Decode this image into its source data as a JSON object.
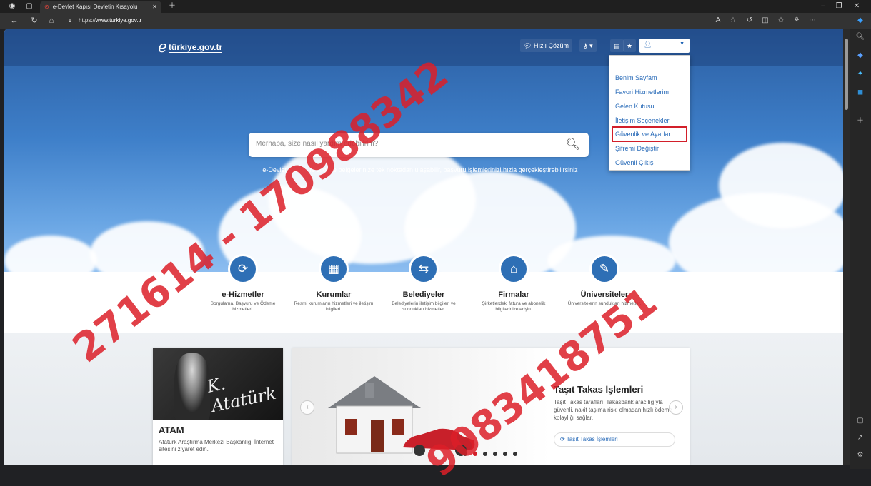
{
  "browser": {
    "tab_title": "e-Devlet Kapısı Devletin Kısayolu",
    "url_prefix": "https://",
    "url_host": "www.turkiye.gov.tr"
  },
  "header": {
    "logo_mark": "e",
    "logo_text": "türkiye.gov.tr",
    "quick_solution": "Hızlı Çözüm"
  },
  "user_menu": {
    "items": [
      "Benim Sayfam",
      "Favori Hizmetlerim",
      "Gelen Kutusu",
      "İletişim Seçenekleri",
      "Güvenlik ve Ayarlar",
      "Şifremi Değiştir",
      "Güvenli Çıkış"
    ],
    "highlighted": "Güvenlik ve Ayarlar"
  },
  "search": {
    "placeholder": "Merhaba, size nasıl yardım edebilirim?",
    "tagline": "e-Devlet Kapısı ile bilgi ve belgelerinize tek noktadan ulaşabilir, başvuru işlemlerinizi hızla gerçekleştirebilirsiniz"
  },
  "services": [
    {
      "name": "e-Hizmetler",
      "desc": "Sorgulama, Başvuru ve Ödeme hizmetleri.",
      "icon": "refresh-icon"
    },
    {
      "name": "Kurumlar",
      "desc": "Resmi kurumların hizmetleri ve iletişim bilgileri.",
      "icon": "building-icon"
    },
    {
      "name": "Belediyeler",
      "desc": "Belediyelerin iletişim bilgileri ve sundukları hizmetler.",
      "icon": "signpost-icon"
    },
    {
      "name": "Firmalar",
      "desc": "Şirketlerdeki fatura ve abonelik bilgilerinize erişin.",
      "icon": "factory-icon"
    },
    {
      "name": "Üniversiteler",
      "desc": "Üniversitelerin sundukları hizmetler.",
      "icon": "graduation-cap-icon"
    }
  ],
  "atam": {
    "signature": "K. Atatürk",
    "title": "ATAM",
    "desc": "Atatürk Araştırma Merkezi Başkanlığı İnternet sitesini ziyaret edin."
  },
  "slider": {
    "title": "Taşıt Takas İşlemleri",
    "desc": "Taşıt Takas tarafları, Takasbank aracılığıyla güvenli, nakit taşıma riski olmadan hızlı ödeme kolaylığı sağlar.",
    "link": "Taşıt Takas İşlemleri",
    "active_dot": 2,
    "dot_count": 6
  },
  "watermark": [
    "271614 - 170988342",
    "9083418751"
  ],
  "colors": {
    "accent": "#2e6fb5",
    "link": "#2a6cb9",
    "highlight_border": "#d21f2a",
    "watermark": "#dc1e28"
  }
}
